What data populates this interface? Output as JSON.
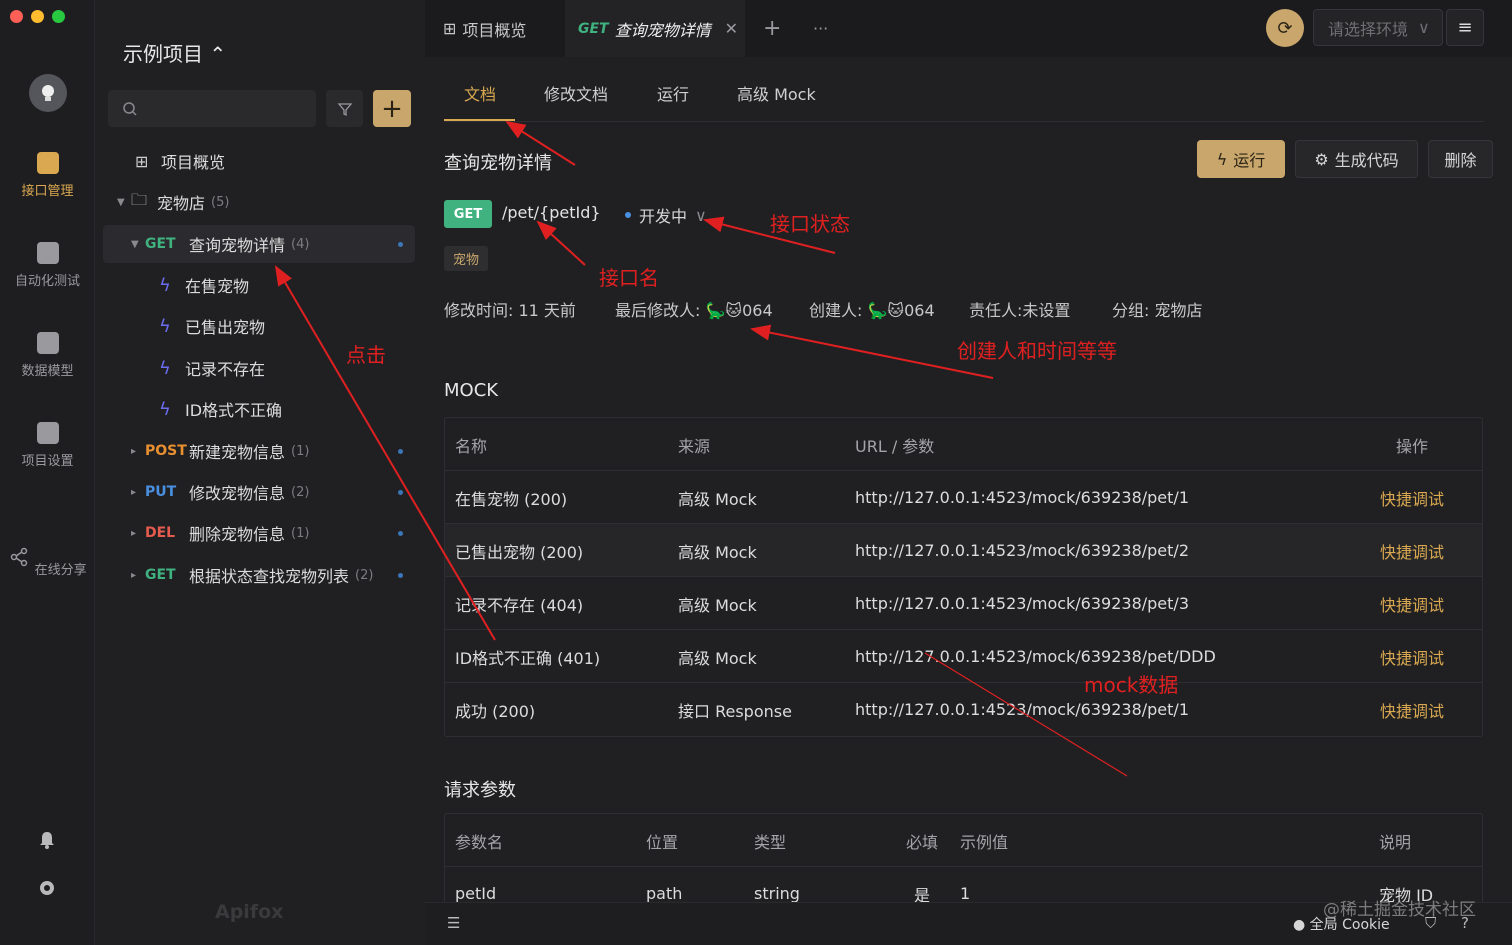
{
  "rail": {
    "items": [
      {
        "label": "接口管理",
        "icon": "api-icon",
        "active": true
      },
      {
        "label": "自动化测试",
        "icon": "test-icon",
        "active": false
      },
      {
        "label": "数据模型",
        "icon": "model-icon",
        "active": false
      },
      {
        "label": "项目设置",
        "icon": "settings-icon",
        "active": false
      },
      {
        "label": "在线分享",
        "icon": "share-icon",
        "active": false
      }
    ]
  },
  "sidebar": {
    "project_title": "示例项目 ⌃",
    "overview": "项目概览",
    "folder": {
      "label": "宠物店",
      "count": "(5)"
    },
    "apis": [
      {
        "method": "GET",
        "label": "查询宠物详情",
        "count": "(4)"
      },
      {
        "method": "POST",
        "label": "新建宠物信息",
        "count": "(1)"
      },
      {
        "method": "PUT",
        "label": "修改宠物信息",
        "count": "(2)"
      },
      {
        "method": "DEL",
        "label": "删除宠物信息",
        "count": "(1)"
      },
      {
        "method": "GET",
        "label": "根据状态查找宠物列表",
        "count": "(2)"
      }
    ],
    "cases": [
      "在售宠物",
      "已售出宠物",
      "记录不存在",
      "ID格式不正确"
    ],
    "brand": "Apifox"
  },
  "tabbar": {
    "tab_overview": "项目概览",
    "tab_active_method": "GET",
    "tab_active_label": "查询宠物详情",
    "env_placeholder": "请选择环境"
  },
  "subtabs": [
    "文档",
    "修改文档",
    "运行",
    "高级 Mock"
  ],
  "api": {
    "title": "查询宠物详情",
    "method": "GET",
    "path": "/pet/{petId}",
    "status": "开发中",
    "tag": "宠物",
    "meta": {
      "modified_time": "修改时间: 11 天前",
      "modifier": "最后修改人: 🦕🐱064",
      "creator": "创建人: 🦕🐱064",
      "owner": "责任人:未设置",
      "group": "分组: 宠物店"
    },
    "buttons": {
      "run": "运行",
      "code": "生成代码",
      "delete": "删除"
    }
  },
  "mock": {
    "title": "MOCK",
    "headers": [
      "名称",
      "来源",
      "URL / 参数",
      "操作"
    ],
    "rows": [
      {
        "name": "在售宠物 (200)",
        "source": "高级 Mock",
        "url": "http://127.0.0.1:4523/mock/639238/pet/1",
        "action": "快捷调试"
      },
      {
        "name": "已售出宠物 (200)",
        "source": "高级 Mock",
        "url": "http://127.0.0.1:4523/mock/639238/pet/2",
        "action": "快捷调试"
      },
      {
        "name": "记录不存在 (404)",
        "source": "高级 Mock",
        "url": "http://127.0.0.1:4523/mock/639238/pet/3",
        "action": "快捷调试"
      },
      {
        "name": "ID格式不正确 (401)",
        "source": "高级 Mock",
        "url": "http://127.0.0.1:4523/mock/639238/pet/DDD",
        "action": "快捷调试"
      },
      {
        "name": "成功 (200)",
        "source": "接口 Response",
        "url": "http://127.0.0.1:4523/mock/639238/pet/1",
        "action": "快捷调试"
      }
    ]
  },
  "params": {
    "title": "请求参数",
    "headers": [
      "参数名",
      "位置",
      "类型",
      "必填",
      "示例值",
      "说明"
    ],
    "row": {
      "name": "petId",
      "position": "path",
      "type": "string",
      "required": "是",
      "example": "1",
      "desc": "宠物 ID"
    }
  },
  "footer": {
    "cookie": "全局 Cookie"
  },
  "annotations": {
    "status": "接口状态",
    "name": "接口名",
    "click": "点击",
    "creator": "创建人和时间等等",
    "mock": "mock数据"
  },
  "watermark": "@稀土掘金技术社区",
  "colors": {
    "accent": "#d9a850",
    "get": "#3fb27f",
    "post": "#e8902f",
    "put": "#4a90e2",
    "del": "#e65b4f",
    "annotation": "#e02020"
  }
}
